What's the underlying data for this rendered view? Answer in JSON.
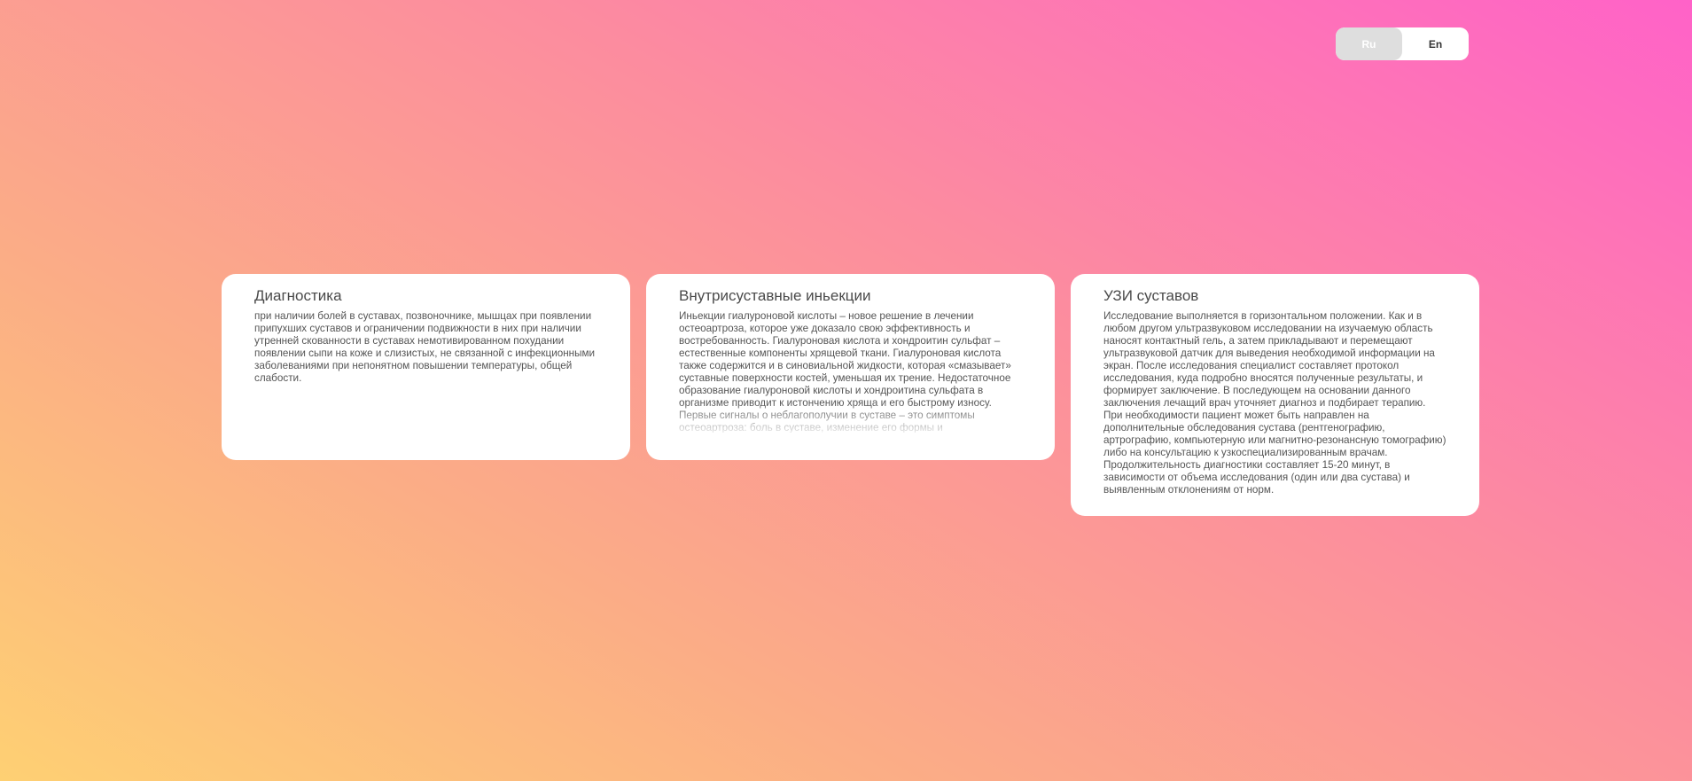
{
  "language_switch": {
    "ru_label": "Ru",
    "en_label": "En",
    "active": "Ru"
  },
  "cards": [
    {
      "title": "Диагностика",
      "text": "при наличии болей в суставах, позвоночнике, мышцах при появлении припухших суставов и ограничении подвижности в них при наличии утренней скованности в суставах немотивированном похудании появлении сыпи на коже и слизистых, не связанной с инфекционными заболеваниями при непонятном повышении температуры, общей слабости."
    },
    {
      "title": "Внутрисуставные иньекции",
      "text": "Иньекции гиалуроновой кислоты – новое решение в лечении остеоартроза, которое уже доказало свою эффективность и востребованность. Гиалуроновая кислота и хондроитин сульфат – естественные компоненты хрящевой ткани. Гиалуроновая кислота также содержится и в синовиальной жидкости, которая «смазывает» суставные поверхности костей, уменьшая их трение. Недостаточное образование гиалуроновой кислоты и хондроитина сульфата в организме приводит к истончению хряща и его быстрому износу. Первые сигналы о неблагополучии в суставе – это симптомы остеоартроза: боль в суставе, изменение его формы и"
    },
    {
      "title": "УЗИ суставов",
      "text": "Исследование выполняется в горизонтальном положении. Как и в любом другом ультразвуковом исследовании на изучаемую область наносят контактный гель, а затем прикладывают и перемещают ультразвуковой датчик для выведения необходимой информации на экран. После исследования специалист составляет протокол исследования, куда подробно вносятся полученные результаты, и формирует заключение. В последующем на основании данного заключения лечащий врач уточняет диагноз и подбирает терапию. При необходимости пациент может быть направлен на дополнительные обследования сустава (рентгенографию, артрографию, компьютерную или магнитно-резонансную томографию) либо на консультацию к узкоспециализированным врачам. Продолжительность диагностики составляет 15-20 минут, в зависимости от объема исследования (один или два сустава) и выявленным отклонениям от норм."
    }
  ]
}
